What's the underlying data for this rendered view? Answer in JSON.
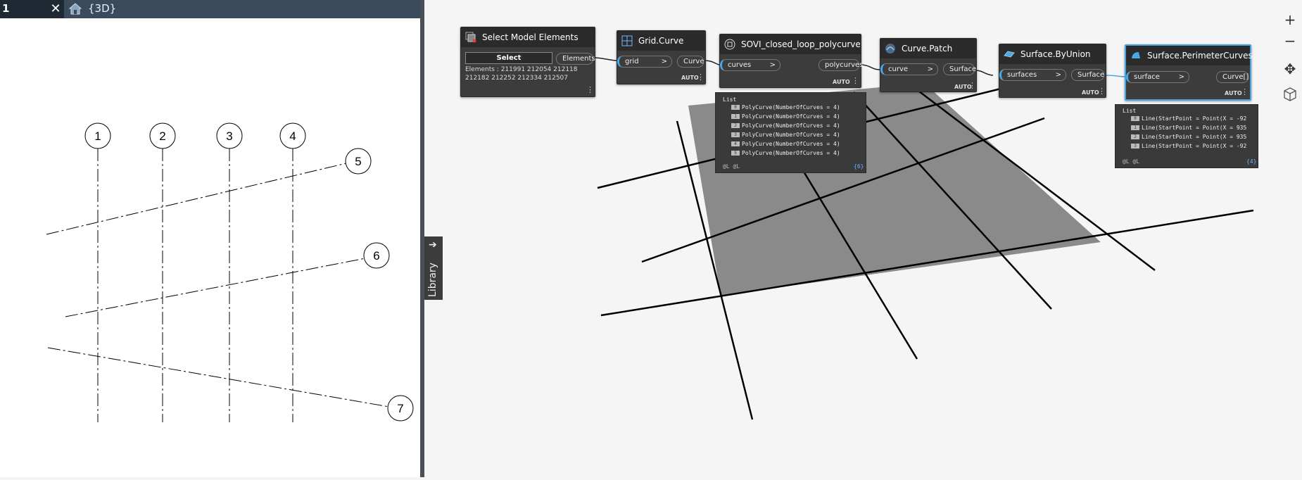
{
  "revit": {
    "tabs": [
      {
        "label": "1"
      },
      {
        "label": "{3D}"
      }
    ],
    "grid_bubbles": [
      "1",
      "2",
      "3",
      "4",
      "5",
      "6",
      "7"
    ]
  },
  "library": {
    "label": "Library"
  },
  "nodes": {
    "select": {
      "title": "Select Model Elements",
      "button": "Select",
      "elements_text_1": "Elements : 211991 212054 212118",
      "elements_text_2": "212182 212252 212334 212507",
      "output": "Elements"
    },
    "grid_curve": {
      "title": "Grid.Curve",
      "input": "grid",
      "output": "Curve",
      "lacing": "AUTO"
    },
    "sovi": {
      "title": "SOVI_closed_loop_polycurve",
      "input": "curves",
      "output": "polycurves",
      "lacing": "AUTO"
    },
    "curve_patch": {
      "title": "Curve.Patch",
      "input": "curve",
      "output": "Surface",
      "lacing": "AUTO"
    },
    "surface_union": {
      "title": "Surface.ByUnion",
      "input": "surfaces",
      "output": "Surface",
      "lacing": "AUTO"
    },
    "perimeter": {
      "title": "Surface.PerimeterCurves",
      "input": "surface",
      "output": "Curve[]",
      "lacing": "AUTO"
    }
  },
  "previews": {
    "sovi": {
      "header": "List",
      "items": [
        {
          "index": "0",
          "text": "PolyCurve(NumberOfCurves = 4)"
        },
        {
          "index": "1",
          "text": "PolyCurve(NumberOfCurves = 4)"
        },
        {
          "index": "2",
          "text": "PolyCurve(NumberOfCurves = 4)"
        },
        {
          "index": "3",
          "text": "PolyCurve(NumberOfCurves = 4)"
        },
        {
          "index": "4",
          "text": "PolyCurve(NumberOfCurves = 4)"
        },
        {
          "index": "5",
          "text": "PolyCurve(NumberOfCurves = 4)"
        }
      ],
      "footer": "@L @L",
      "count": "{6}"
    },
    "perimeter": {
      "header": "List",
      "items": [
        {
          "index": "0",
          "text": "Line(StartPoint = Point(X = -92"
        },
        {
          "index": "1",
          "text": "Line(StartPoint = Point(X = 935"
        },
        {
          "index": "2",
          "text": "Line(StartPoint = Point(X = 935"
        },
        {
          "index": "3",
          "text": "Line(StartPoint = Point(X = -92"
        }
      ],
      "footer": "@L @L",
      "count": "{4}"
    }
  },
  "controls": {
    "zoom_in": "+",
    "zoom_out": "−",
    "pan": "✥"
  },
  "colors": {
    "accent": "#47a2e0",
    "node_bg": "#3c3c3c",
    "surface_fill": "#8a8a8a"
  }
}
